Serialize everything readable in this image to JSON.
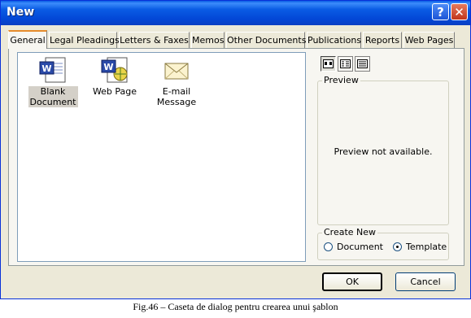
{
  "window": {
    "title": "New"
  },
  "titlebar_buttons": {
    "help": "?",
    "close": "✕"
  },
  "tabs": [
    {
      "label": "General",
      "active": true
    },
    {
      "label": "Legal Pleadings"
    },
    {
      "label": "Letters & Faxes"
    },
    {
      "label": "Memos"
    },
    {
      "label": "Other Documents"
    },
    {
      "label": "Publications"
    },
    {
      "label": "Reports"
    },
    {
      "label": "Web Pages"
    }
  ],
  "templates": [
    {
      "label_1": "Blank",
      "label_2": "Document",
      "icon": "word-document-icon",
      "selected": true
    },
    {
      "label_1": "Web Page",
      "label_2": "",
      "icon": "web-page-icon"
    },
    {
      "label_1": "E-mail",
      "label_2": "Message",
      "icon": "envelope-icon"
    }
  ],
  "view_buttons": [
    "large-icons-view-icon",
    "list-view-icon",
    "details-view-icon"
  ],
  "preview": {
    "title": "Preview",
    "message": "Preview not available."
  },
  "create_new": {
    "title": "Create New",
    "document_label": "Document",
    "template_label": "Template",
    "selected": "Template"
  },
  "buttons": {
    "ok": "OK",
    "cancel": "Cancel"
  },
  "caption": "Fig.46 – Caseta de dialog pentru crearea unui şablon",
  "colors": {
    "title_bar": "#0a5ce4",
    "dialog_bg": "#ece9d8",
    "tab_highlight": "#e68b2c",
    "close_button": "#c2361c"
  }
}
